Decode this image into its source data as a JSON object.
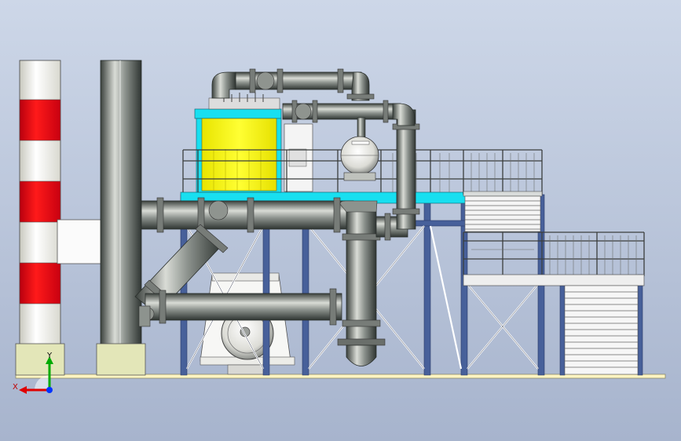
{
  "axis_triad": {
    "x_label": "X",
    "y_label": "Y"
  },
  "colors": {
    "background_top": "#cdd7e8",
    "background_bottom": "#a9b6cf",
    "steel_blue": "#47609a",
    "cyan_platform": "#18dff0",
    "yellow_box": "#f6f200",
    "pipe_light": "#c9ccc6",
    "pipe_dark": "#3f4541",
    "chimney_red": "#e60012",
    "footing": "#e3e6b8",
    "ground_line": "#fff7c0"
  }
}
